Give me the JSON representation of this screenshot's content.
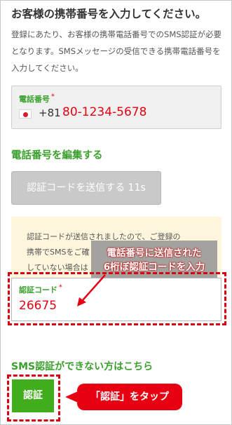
{
  "page": {
    "title": "お客様の携帯番号を入力してください。",
    "description": "登録にあたり、お客様の携帯電話番号でのSMS認証が必要となります。SMSメッセージの受信できる携帯電話番号を入力してください。"
  },
  "phone_field": {
    "label": "電話番号",
    "required_mark": "*",
    "country_code": "+81",
    "value": "80-1234-5678"
  },
  "edit_link": "電話番号を編集する",
  "send_code_button": "認証コードを送信する 11s",
  "notice": {
    "line1": "認証コードが送信されましたので、ご登録の",
    "line2": "携帯でSMSをご確",
    "line3": "していない場合は"
  },
  "callout": {
    "line1": "電話番号に送信された",
    "line2": "6桁ぼ認証コードを入力"
  },
  "code_field": {
    "label": "認証コード",
    "required_mark": "*",
    "value": "26675"
  },
  "sms_help_link": "SMS認証ができない方はこちら",
  "auth_button": "認証",
  "tap_callout": "「認証」をタップ",
  "colors": {
    "accent_green": "#3aa02c",
    "button_green": "#41ad1c",
    "annotation_red": "#e60012",
    "notice_bg": "#fdf6dd"
  }
}
